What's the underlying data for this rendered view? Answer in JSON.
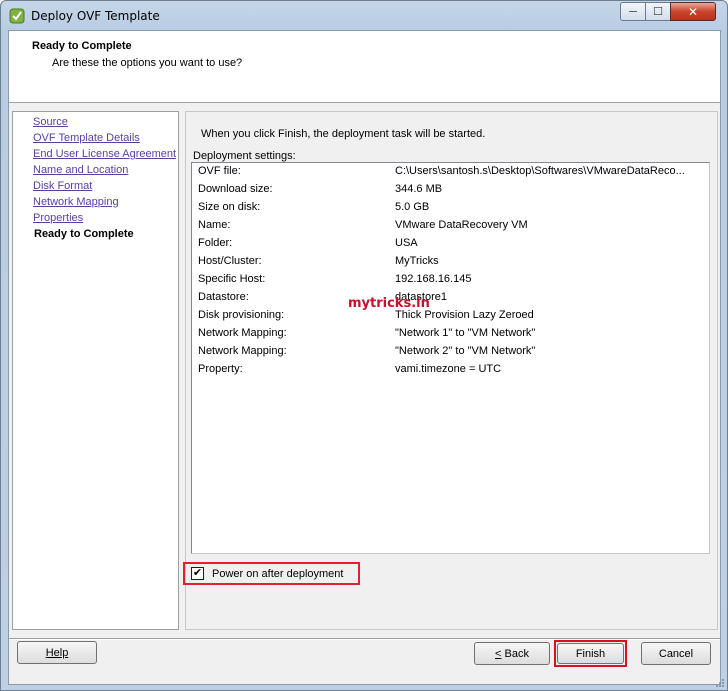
{
  "window": {
    "title": "Deploy OVF Template",
    "controls": {
      "minimize": "─",
      "maximize": "☐",
      "close": "✕"
    }
  },
  "header": {
    "title": "Ready to Complete",
    "subtitle": "Are these the options you want to use?"
  },
  "nav": {
    "items": [
      {
        "label": "Source",
        "current": false
      },
      {
        "label": "OVF Template Details",
        "current": false
      },
      {
        "label": "End User License Agreement",
        "current": false
      },
      {
        "label": "Name and Location",
        "current": false
      },
      {
        "label": "Disk Format",
        "current": false
      },
      {
        "label": "Network Mapping",
        "current": false
      },
      {
        "label": "Properties",
        "current": false
      },
      {
        "label": "Ready to Complete",
        "current": true
      }
    ]
  },
  "main": {
    "intro": "When you click Finish, the deployment task will be started.",
    "settings_label": "Deployment settings:",
    "settings": [
      {
        "key": "OVF file:",
        "value": "C:\\Users\\santosh.s\\Desktop\\Softwares\\VMwareDataReco..."
      },
      {
        "key": "Download size:",
        "value": "344.6 MB"
      },
      {
        "key": "Size on disk:",
        "value": "5.0 GB"
      },
      {
        "key": "Name:",
        "value": "VMware DataRecovery VM"
      },
      {
        "key": "Folder:",
        "value": "USA"
      },
      {
        "key": "Host/Cluster:",
        "value": "MyTricks"
      },
      {
        "key": "Specific Host:",
        "value": "192.168.16.145"
      },
      {
        "key": "Datastore:",
        "value": "datastore1"
      },
      {
        "key": "Disk provisioning:",
        "value": "Thick Provision Lazy Zeroed"
      },
      {
        "key": "Network Mapping:",
        "value": "\"Network 1\" to \"VM Network\""
      },
      {
        "key": "Network Mapping:",
        "value": "\"Network 2\" to \"VM Network\""
      },
      {
        "key": "Property:",
        "value": "vami.timezone = UTC"
      }
    ],
    "watermark": "mytricks.in",
    "power_on": {
      "label": "Power on after deployment",
      "checked": true,
      "check_glyph": "✔"
    }
  },
  "buttons": {
    "help": "Help",
    "back_prefix": "<",
    "back": " Back",
    "finish": "Finish",
    "cancel": "Cancel"
  },
  "colors": {
    "highlight": "#e0222d",
    "link": "#5a3fa0",
    "watermark": "#c8102e"
  }
}
